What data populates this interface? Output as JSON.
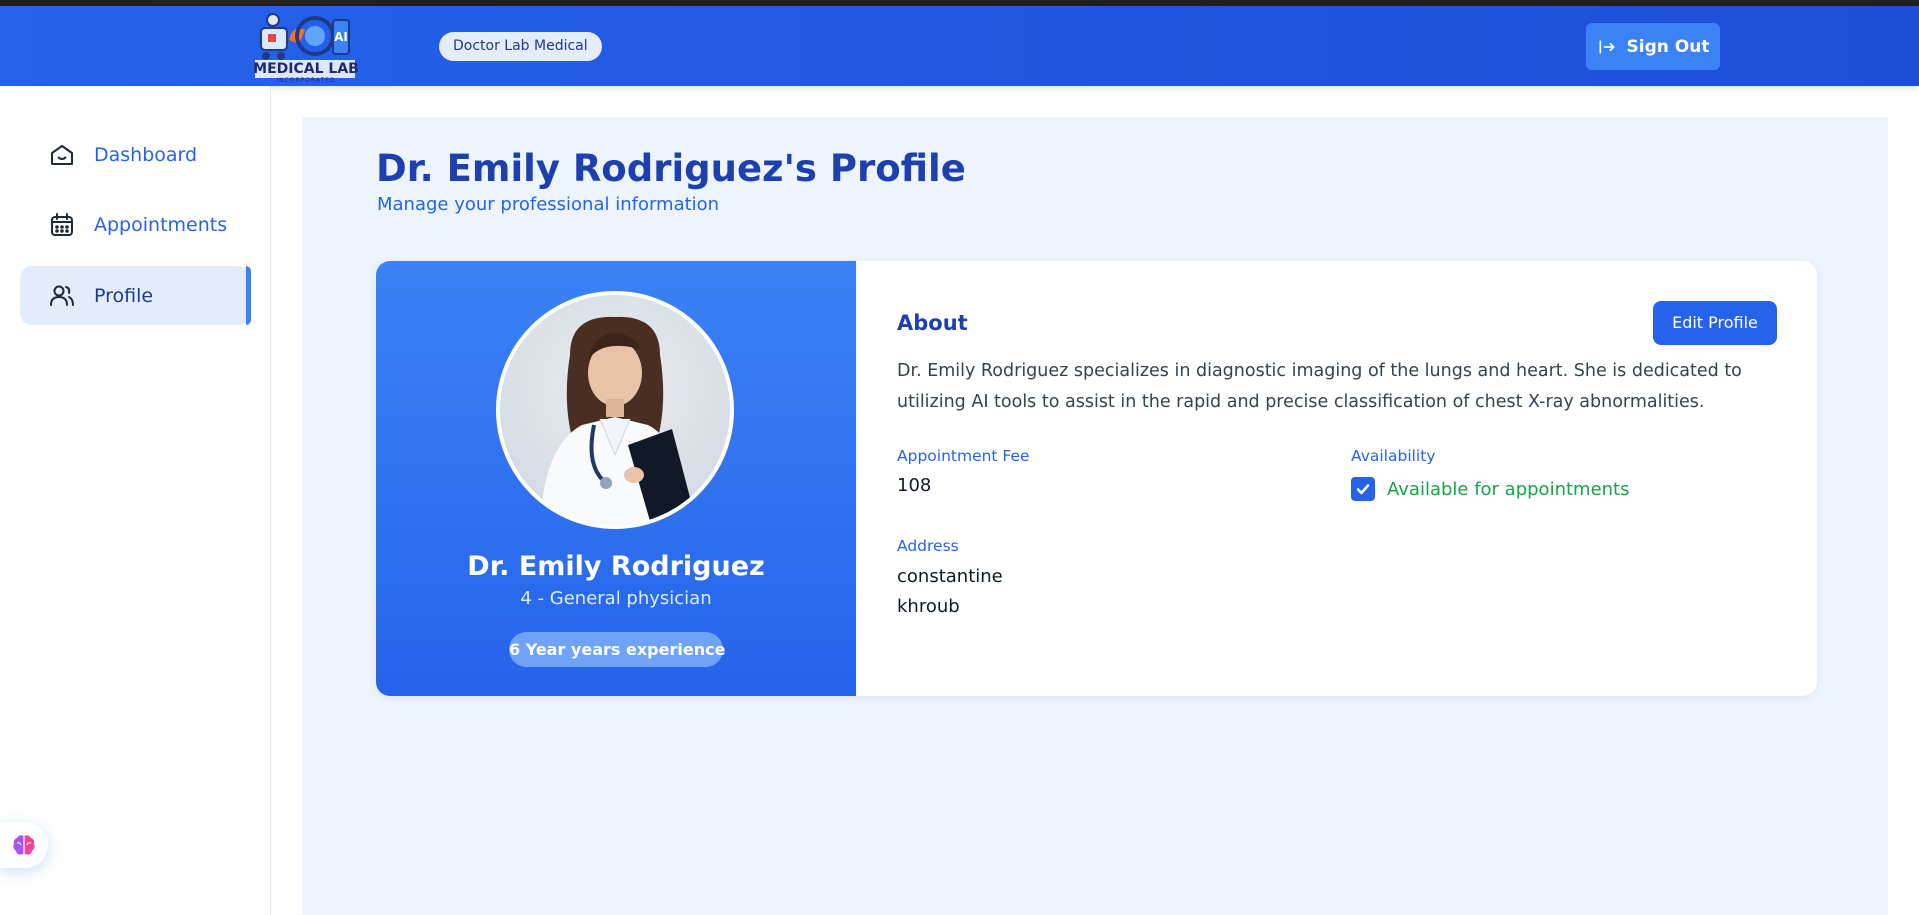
{
  "header": {
    "logo_text": "MEDICAL LAB",
    "logo_sub": "INCORPORATED",
    "badge": "Doctor Lab Medical",
    "signout_label": "Sign Out"
  },
  "sidebar": {
    "items": [
      {
        "label": "Dashboard",
        "icon": "home-icon"
      },
      {
        "label": "Appointments",
        "icon": "calendar-icon"
      },
      {
        "label": "Profile",
        "icon": "users-icon",
        "active": true
      }
    ],
    "ai_button_icon": "brain-icon"
  },
  "page": {
    "title": "Dr. Emily Rodriguez's Profile",
    "subtitle": "Manage your professional information"
  },
  "profile": {
    "name": "Dr. Emily Rodriguez",
    "specialty": "4 - General physician",
    "experience": "6 Year years experience",
    "about_title": "About",
    "edit_label": "Edit Profile",
    "about": "Dr. Emily Rodriguez specializes in diagnostic imaging of the lungs and heart. She is dedicated to utilizing AI tools to assist in the rapid and precise classification of chest X-ray abnormalities.",
    "fee_label": "Appointment Fee",
    "fee_value": "108",
    "availability_label": "Availability",
    "availability_value": "Available for appointments",
    "available": true,
    "address_label": "Address",
    "address_line1": "constantine",
    "address_line2": "khroub"
  },
  "colors": {
    "primary": "#2563eb",
    "dark_blue": "#1e40af",
    "success": "#16a34a",
    "page_bg": "#eef4fe"
  }
}
